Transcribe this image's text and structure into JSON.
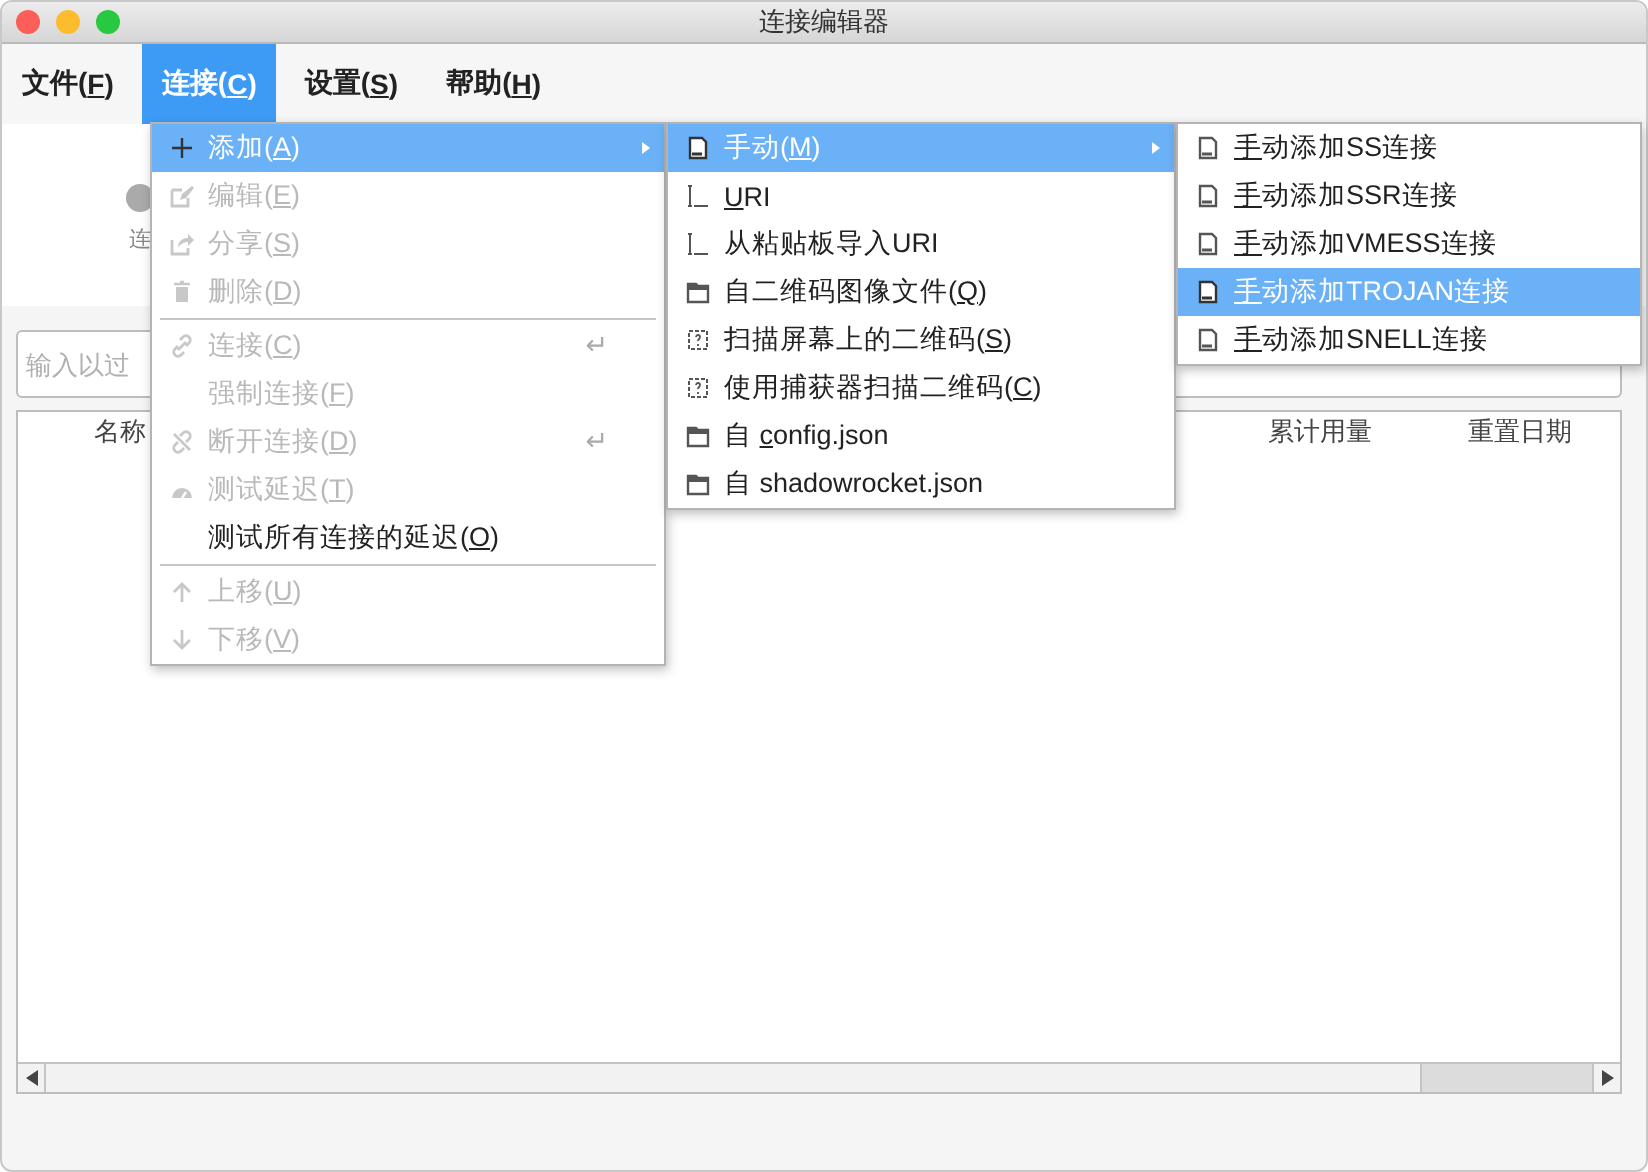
{
  "window": {
    "title": "连接编辑器"
  },
  "menu_bar": [
    {
      "pre": "文件(",
      "key": "F",
      "post": ")",
      "selected": false
    },
    {
      "pre": "连接(",
      "key": "C",
      "post": ")",
      "selected": true
    },
    {
      "pre": "设置(",
      "key": "S",
      "post": ")",
      "selected": false
    },
    {
      "pre": "帮助(",
      "key": "H",
      "post": ")",
      "selected": false
    }
  ],
  "toolbar": {
    "buttons": [
      {
        "label": "连"
      }
    ]
  },
  "filter": {
    "placeholder": "输入以过"
  },
  "table": {
    "columns": [
      {
        "label": "名称"
      },
      {
        "label": "累计用量"
      },
      {
        "label": "重置日期"
      }
    ]
  },
  "menus": [
    {
      "items": [
        {
          "kind": "item",
          "pre": "添加(",
          "key": "A",
          "post": ")",
          "selected": true,
          "disabled": false,
          "submenu": true
        },
        {
          "kind": "item",
          "pre": "编辑(",
          "key": "E",
          "post": ")",
          "selected": false,
          "disabled": true,
          "submenu": false
        },
        {
          "kind": "item",
          "pre": "分享(",
          "key": "S",
          "post": ")",
          "selected": false,
          "disabled": true,
          "submenu": false
        },
        {
          "kind": "item",
          "pre": "删除(",
          "key": "D",
          "post": ")",
          "selected": false,
          "disabled": true,
          "submenu": false
        },
        {
          "kind": "separator"
        },
        {
          "kind": "item",
          "pre": "连接(",
          "key": "C",
          "post": ")",
          "selected": false,
          "disabled": true,
          "submenu": false,
          "shortcut": "↵"
        },
        {
          "kind": "item",
          "pre": "强制连接(",
          "key": "F",
          "post": ")",
          "selected": false,
          "disabled": true,
          "submenu": false
        },
        {
          "kind": "item",
          "pre": "断开连接(",
          "key": "D",
          "post": ")",
          "selected": false,
          "disabled": true,
          "submenu": false,
          "shortcut": "↵"
        },
        {
          "kind": "item",
          "pre": "测试延迟(",
          "key": "T",
          "post": ")",
          "selected": false,
          "disabled": true,
          "submenu": false
        },
        {
          "kind": "item",
          "pre": "测试所有连接的延迟(",
          "key": "O",
          "post": ")",
          "selected": false,
          "disabled": false,
          "submenu": false
        },
        {
          "kind": "separator"
        },
        {
          "kind": "item",
          "pre": "上移(",
          "key": "U",
          "post": ")",
          "selected": false,
          "disabled": true,
          "submenu": false
        },
        {
          "kind": "item",
          "pre": "下移(",
          "key": "V",
          "post": ")",
          "selected": false,
          "disabled": true,
          "submenu": false
        }
      ]
    },
    {
      "items": [
        {
          "kind": "item",
          "pre": "手动(",
          "key": "M",
          "post": ")",
          "selected": true,
          "disabled": false,
          "submenu": true
        },
        {
          "kind": "item",
          "key": "U",
          "post": "RI",
          "selected": false,
          "disabled": false,
          "submenu": false
        },
        {
          "kind": "item",
          "pre": "从粘贴板导入URI",
          "selected": false,
          "disabled": false,
          "submenu": false
        },
        {
          "kind": "item",
          "pre": "自二维码图像文件(",
          "key": "Q",
          "post": ")",
          "selected": false,
          "disabled": false,
          "submenu": false
        },
        {
          "kind": "item",
          "pre": "扫描屏幕上的二维码(",
          "key": "S",
          "post": ")",
          "selected": false,
          "disabled": false,
          "submenu": false
        },
        {
          "kind": "item",
          "pre": "使用捕获器扫描二维码(",
          "key": "C",
          "post": ")",
          "selected": false,
          "disabled": false,
          "submenu": false
        },
        {
          "kind": "item",
          "pre": "自 ",
          "key": "c",
          "post": "onfig.json",
          "selected": false,
          "disabled": false,
          "submenu": false
        },
        {
          "kind": "item",
          "pre": "自 shadowrocket.json",
          "selected": false,
          "disabled": false,
          "submenu": false
        }
      ]
    },
    {
      "items": [
        {
          "kind": "item",
          "key": "手",
          "post": "动添加SS连接",
          "selected": false,
          "disabled": false,
          "submenu": false
        },
        {
          "kind": "item",
          "key": "手",
          "post": "动添加SSR连接",
          "selected": false,
          "disabled": false,
          "submenu": false
        },
        {
          "kind": "item",
          "key": "手",
          "post": "动添加VMESS连接",
          "selected": false,
          "disabled": false,
          "submenu": false
        },
        {
          "kind": "item",
          "key": "手",
          "post": "动添加TROJAN连接",
          "selected": true,
          "disabled": false,
          "submenu": false
        },
        {
          "kind": "item",
          "key": "手",
          "post": "动添加SNELL连接",
          "selected": false,
          "disabled": false,
          "submenu": false
        }
      ]
    }
  ]
}
